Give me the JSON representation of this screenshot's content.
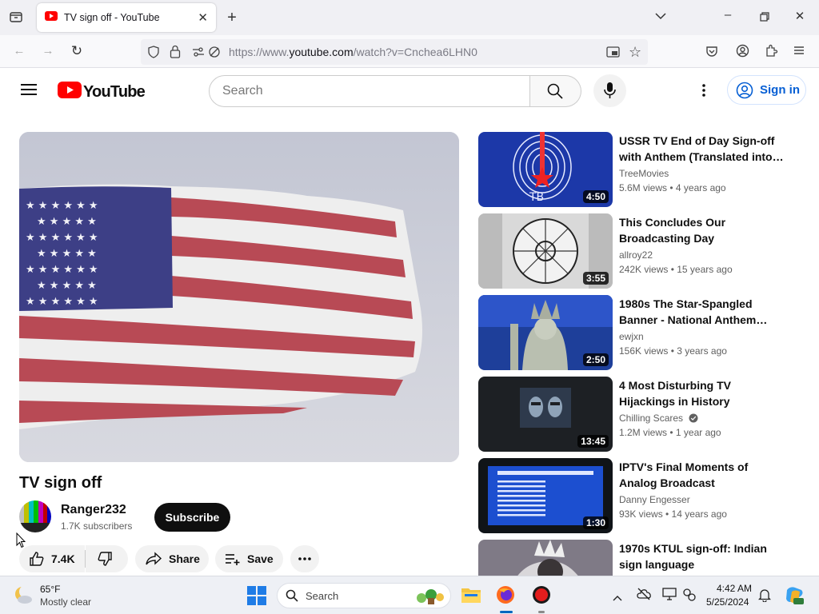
{
  "browser": {
    "tab_title": "TV sign off - YouTube",
    "url_prefix": "https://www.",
    "url_host": "youtube.com",
    "url_path": "/watch?v=Cnchea6LHN0"
  },
  "header": {
    "logo_text": "YouTube",
    "search_placeholder": "Search",
    "signin_label": "Sign in"
  },
  "video": {
    "title": "TV sign off",
    "channel": "Ranger232",
    "subscribers": "1.7K subscribers",
    "subscribe_label": "Subscribe",
    "likes": "7.4K",
    "share_label": "Share",
    "save_label": "Save"
  },
  "recommendations": [
    {
      "title": "USSR TV End of Day Sign-off with Anthem (Translated into…",
      "channel": "TreeMovies",
      "meta": "5.6M views  •  4 years ago",
      "duration": "4:50",
      "verified": false
    },
    {
      "title": "This Concludes Our Broadcasting Day",
      "channel": "allroy22",
      "meta": "242K views  •  15 years ago",
      "duration": "3:55",
      "verified": false
    },
    {
      "title": "1980s The Star-Spangled Banner - National Anthem…",
      "channel": "ewjxn",
      "meta": "156K views  •  3 years ago",
      "duration": "2:50",
      "verified": false
    },
    {
      "title": "4 Most Disturbing TV Hijackings in History",
      "channel": "Chilling Scares",
      "meta": "1.2M views  •  1 year ago",
      "duration": "13:45",
      "verified": true
    },
    {
      "title": "IPTV's Final Moments of Analog Broadcast",
      "channel": "Danny Engesser",
      "meta": "93K views  •  14 years ago",
      "duration": "1:30",
      "verified": false
    },
    {
      "title": "1970s KTUL sign-off: Indian sign language",
      "channel": "",
      "meta": "",
      "duration": "",
      "verified": false
    }
  ],
  "taskbar": {
    "temperature": "65°F",
    "weather": "Mostly clear",
    "search_label": "Search",
    "time": "4:42 AM",
    "date": "5/25/2024"
  },
  "colors": {
    "youtube_red": "#ff0000",
    "link_blue": "#065fd4"
  }
}
